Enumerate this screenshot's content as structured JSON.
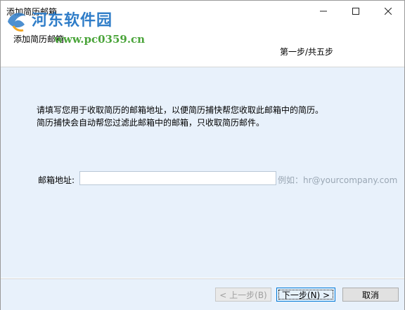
{
  "window": {
    "title": "添加简历邮箱"
  },
  "header": {
    "title": "添加简历邮箱",
    "step": "第一步/共五步"
  },
  "watermark": {
    "name": "河东软件园",
    "url": "www.pc0359.cn",
    "logo_icon": "fish-logo-icon"
  },
  "content": {
    "instruction_line1": "请填写您用于收取简历的邮箱地址，以便简历捕快帮您收取此邮箱中的简历。",
    "instruction_line2": "简历捕快会自动帮您过滤此邮箱中的邮箱，只收取简历邮件。",
    "email_label": "邮箱地址:",
    "email_value": "",
    "email_hint": "例如：hr@yourcompany.com"
  },
  "footer": {
    "prev_label": "< 上一步(B)",
    "next_label": "下一步(N) >",
    "cancel_label": "取消"
  },
  "colors": {
    "content_bg": "#e8f1fb",
    "watermark_blue": "#2f7dc8",
    "watermark_green": "#4aa43a",
    "accent": "#0078d7"
  }
}
